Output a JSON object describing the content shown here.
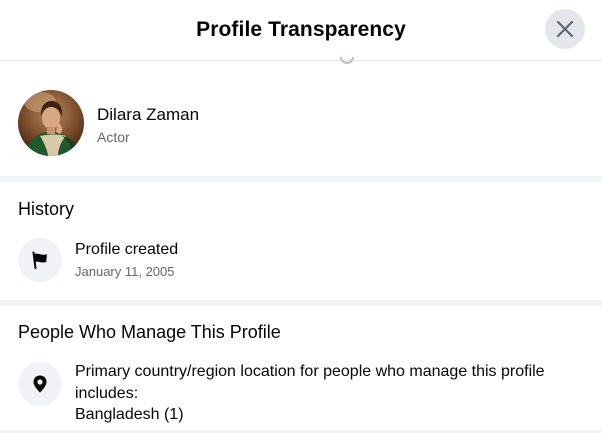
{
  "dialog": {
    "title": "Profile Transparency",
    "close_icon": "close-icon"
  },
  "profile": {
    "name": "Dilara Zaman",
    "role": "Actor"
  },
  "history": {
    "title": "History",
    "items": [
      {
        "icon": "flag-icon",
        "label": "Profile created",
        "date": "January 11, 2005"
      }
    ]
  },
  "managers": {
    "title": "People Who Manage This Profile",
    "items": [
      {
        "icon": "location-pin-icon",
        "label": "Primary country/region location for people who manage this profile includes:",
        "value": "Bangladesh (1)"
      }
    ]
  },
  "colors": {
    "divider": "#f0f2f5",
    "secondary_text": "#65676b",
    "icon_bg": "#f0f2f5",
    "close_bg": "#e4e6eb"
  }
}
